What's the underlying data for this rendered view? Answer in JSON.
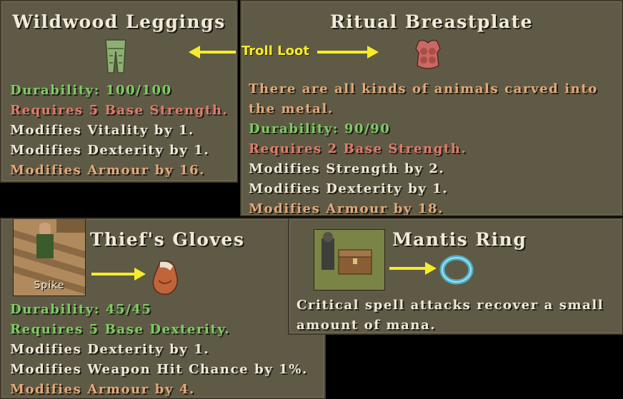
{
  "annotation": {
    "label": "Troll Loot",
    "color": "#f7ec2a"
  },
  "colors": {
    "panel": "#5f5a46",
    "durability": "#7ccc62",
    "requirement": "#e07a68",
    "modifier": "#eee8d8",
    "armour": "#e2a878"
  },
  "items": {
    "leggings": {
      "name": "Wildwood Leggings",
      "icon": "green-leggings-icon",
      "lines": [
        "Durability: 100/100",
        "Requires 5 Base Strength.",
        "Modifies Vitality by 1.",
        "Modifies Dexterity by 1.",
        "Modifies Armour by 16."
      ]
    },
    "breastplate": {
      "name": "Ritual Breastplate",
      "icon": "red-breastplate-icon",
      "lines": [
        "There are all kinds of animals carved into",
        "the metal.",
        "Durability: 90/90",
        "Requires 2 Base Strength.",
        "Modifies Strength by 2.",
        "Modifies Dexterity by 1.",
        "Modifies Armour by 18."
      ]
    },
    "gloves": {
      "name": "Thief's Gloves",
      "icon": "orange-gloves-icon",
      "source_label": "Spike",
      "lines": [
        "Durability: 45/45",
        "Requires 5 Base Dexterity.",
        "Modifies Dexterity by 1.",
        "Modifies Weapon Hit Chance by 1%.",
        "Modifies Armour by 4."
      ]
    },
    "ring": {
      "name": "Mantis Ring",
      "icon": "blue-ring-icon",
      "lines": [
        "Critical spell attacks recover a small",
        "amount of mana."
      ]
    }
  }
}
